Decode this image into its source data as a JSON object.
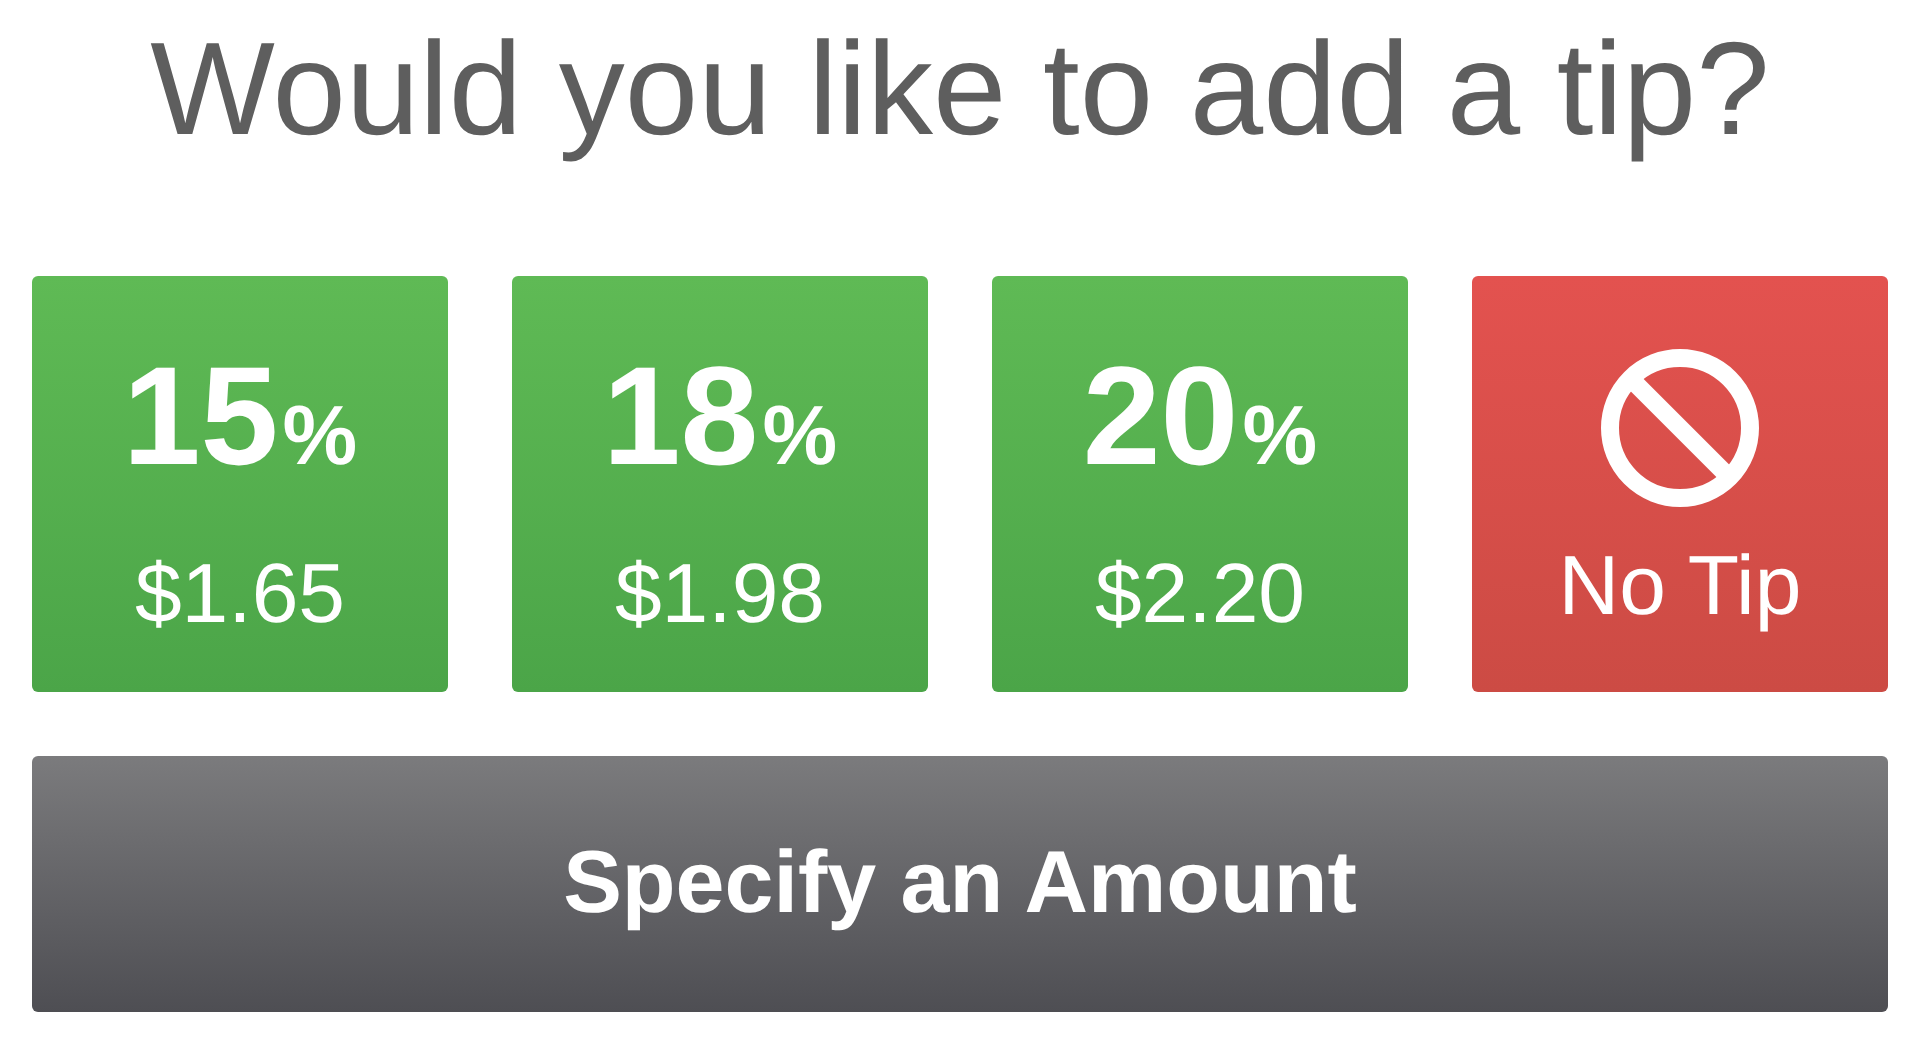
{
  "title": "Would you like to add a tip?",
  "tip_options": [
    {
      "kind": "percent",
      "percent": "15",
      "unit": "%",
      "amount": "$1.65"
    },
    {
      "kind": "percent",
      "percent": "18",
      "unit": "%",
      "amount": "$1.98"
    },
    {
      "kind": "percent",
      "percent": "20",
      "unit": "%",
      "amount": "$2.20"
    },
    {
      "kind": "none",
      "label": "No Tip"
    }
  ],
  "custom_button": "Specify an Amount"
}
